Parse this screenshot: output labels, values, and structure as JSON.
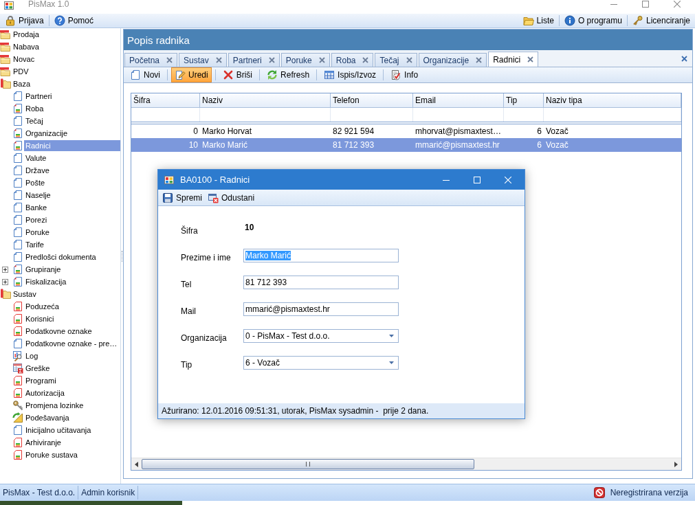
{
  "window": {
    "title": "PisMax 1.0"
  },
  "menu_bar": {
    "left": [
      {
        "label": "Prijava",
        "kind": "lock"
      },
      {
        "label": "Pomoć",
        "kind": "help"
      }
    ],
    "right": [
      {
        "label": "Liste",
        "kind": "folder"
      },
      {
        "label": "O programu",
        "kind": "info"
      },
      {
        "label": "Licenciranje",
        "kind": "key"
      }
    ]
  },
  "sidebar": {
    "items": [
      {
        "label": "Prodaja",
        "kind": "folder",
        "expanded": false,
        "selected": false
      },
      {
        "label": "Nabava",
        "kind": "folder",
        "expanded": false,
        "selected": false
      },
      {
        "label": "Novac",
        "kind": "folder",
        "expanded": false,
        "selected": false
      },
      {
        "label": "PDV",
        "kind": "folder",
        "expanded": false,
        "selected": false
      },
      {
        "label": "Baza",
        "kind": "folder",
        "expanded": true,
        "selected": false,
        "children": [
          {
            "label": "Partneri",
            "kind": "page",
            "selected": false
          },
          {
            "label": "Roba",
            "kind": "report",
            "selected": false
          },
          {
            "label": "Tečaj",
            "kind": "page",
            "selected": false
          },
          {
            "label": "Organizacije",
            "kind": "report",
            "selected": false
          },
          {
            "label": "Radnici",
            "kind": "report",
            "selected": true
          },
          {
            "label": "Valute",
            "kind": "page",
            "selected": false
          },
          {
            "label": "Države",
            "kind": "page",
            "selected": false
          },
          {
            "label": "Pošte",
            "kind": "page",
            "selected": false
          },
          {
            "label": "Naselje",
            "kind": "page",
            "selected": false
          },
          {
            "label": "Banke",
            "kind": "page",
            "selected": false
          },
          {
            "label": "Porezi",
            "kind": "page",
            "selected": false
          },
          {
            "label": "Poruke",
            "kind": "page",
            "selected": false
          },
          {
            "label": "Tarife",
            "kind": "page",
            "selected": false
          },
          {
            "label": "Predlošci dokumenta",
            "kind": "page",
            "selected": false
          },
          {
            "label": "Grupiranje",
            "kind": "report",
            "expanded": false,
            "selected": false
          },
          {
            "label": "Fiskalizacija",
            "kind": "report",
            "expanded": false,
            "selected": false
          }
        ]
      },
      {
        "label": "Sustav",
        "kind": "folder",
        "expanded": true,
        "selected": false,
        "children": [
          {
            "label": "Poduzeća",
            "kind": "form",
            "selected": false
          },
          {
            "label": "Korisnici",
            "kind": "form",
            "selected": false
          },
          {
            "label": "Podatkovne oznake",
            "kind": "form",
            "selected": false
          },
          {
            "label": "Podatkovne oznake - pre…",
            "kind": "page",
            "selected": false
          },
          {
            "label": "Log",
            "kind": "log",
            "selected": false
          },
          {
            "label": "Greške",
            "kind": "grid",
            "selected": false
          },
          {
            "label": "Programi",
            "kind": "form",
            "selected": false
          },
          {
            "label": "Autorizacija",
            "kind": "form",
            "selected": false
          },
          {
            "label": "Promjena lozinke",
            "kind": "keys",
            "selected": false
          },
          {
            "label": "Podešavanja",
            "kind": "settings",
            "selected": false
          },
          {
            "label": "Inicijalno učitavanja",
            "kind": "page",
            "selected": false
          },
          {
            "label": "Arhiviranje",
            "kind": "form",
            "selected": false
          },
          {
            "label": "Poruke sustava",
            "kind": "form",
            "selected": false
          }
        ]
      }
    ]
  },
  "panel": {
    "title": "Popis radnika",
    "tabs": [
      {
        "label": "Početna",
        "selected": false
      },
      {
        "label": "Sustav",
        "selected": false
      },
      {
        "label": "Partneri",
        "selected": false
      },
      {
        "label": "Poruke",
        "selected": false
      },
      {
        "label": "Roba",
        "selected": false
      },
      {
        "label": "Tečaj",
        "selected": false
      },
      {
        "label": "Organizacije",
        "selected": false
      },
      {
        "label": "Radnici",
        "selected": true
      }
    ],
    "toolbar": [
      {
        "label": "Novi",
        "kind": "new",
        "active": false
      },
      {
        "label": "Uredi",
        "kind": "edit",
        "active": true
      },
      {
        "label": "Briši",
        "kind": "delete",
        "active": false
      },
      {
        "label": "Refresh",
        "kind": "refresh",
        "active": false
      },
      {
        "label": "Ispis/Izvoz",
        "kind": "export",
        "active": false
      },
      {
        "label": "Info",
        "kind": "info",
        "active": false
      }
    ],
    "table": {
      "columns": [
        {
          "label": "Šifra",
          "kind": "number"
        },
        {
          "label": "Naziv",
          "kind": "text"
        },
        {
          "label": "Telefon",
          "kind": "text"
        },
        {
          "label": "Email",
          "kind": "text"
        },
        {
          "label": "Tip",
          "kind": "number"
        },
        {
          "label": "Naziv tipa",
          "kind": "text"
        }
      ],
      "rows": [
        {
          "cells": [
            "0",
            "Marko Horvat",
            "82 921 594",
            "mhorvat@pismaxtest…",
            "6",
            "Vozač"
          ],
          "selected": false
        },
        {
          "cells": [
            "10",
            "Marko Marić",
            "81 712 393",
            "mmarić@pismaxtest.hr",
            "6",
            "Vozač"
          ],
          "selected": true
        }
      ]
    }
  },
  "dialog": {
    "title": "BA0100 - Radnici",
    "toolbar": [
      {
        "label": "Spremi",
        "kind": "save"
      },
      {
        "label": "Odustani",
        "kind": "cancel"
      }
    ],
    "fields": [
      {
        "label": "Šifra",
        "kind": "static",
        "value": "10"
      },
      {
        "label": "Prezime i ime",
        "kind": "text",
        "value": "Marko Marić",
        "text_selected": true
      },
      {
        "label": "Tel",
        "kind": "text",
        "value": "81 712 393",
        "text_selected": false
      },
      {
        "label": "Mail",
        "kind": "text",
        "value": "mmarić@pismaxtest.hr",
        "text_selected": false
      },
      {
        "label": "Organizacija",
        "kind": "dropdown",
        "value": "0 - PisMax - Test d.o.o."
      },
      {
        "label": "Tip",
        "kind": "dropdown",
        "value": "6 - Vozač"
      }
    ],
    "status": "Ažurirano: 12.01.2016 09:51:31, utorak, PisMax sysadmin -  prije 2 dana."
  },
  "status_bar": {
    "company": "PisMax - Test d.o.o.",
    "user": "Admin korisnik",
    "license": "Neregistrirana verzija"
  }
}
